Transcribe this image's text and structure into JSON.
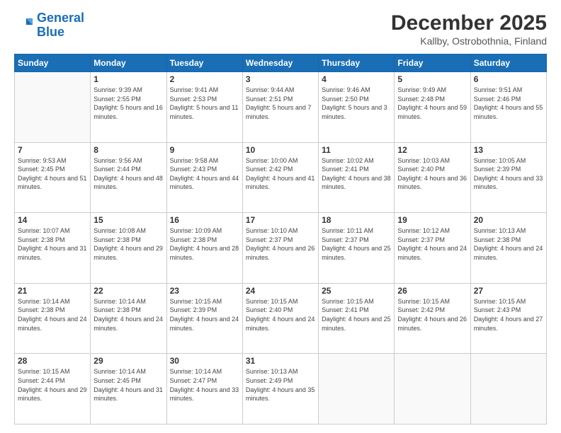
{
  "header": {
    "logo_line1": "General",
    "logo_line2": "Blue",
    "title": "December 2025",
    "subtitle": "Kallby, Ostrobothnia, Finland"
  },
  "calendar": {
    "weekdays": [
      "Sunday",
      "Monday",
      "Tuesday",
      "Wednesday",
      "Thursday",
      "Friday",
      "Saturday"
    ],
    "weeks": [
      [
        {
          "day": "",
          "empty": true
        },
        {
          "day": "1",
          "sunrise": "Sunrise: 9:39 AM",
          "sunset": "Sunset: 2:55 PM",
          "daylight": "Daylight: 5 hours and 16 minutes."
        },
        {
          "day": "2",
          "sunrise": "Sunrise: 9:41 AM",
          "sunset": "Sunset: 2:53 PM",
          "daylight": "Daylight: 5 hours and 11 minutes."
        },
        {
          "day": "3",
          "sunrise": "Sunrise: 9:44 AM",
          "sunset": "Sunset: 2:51 PM",
          "daylight": "Daylight: 5 hours and 7 minutes."
        },
        {
          "day": "4",
          "sunrise": "Sunrise: 9:46 AM",
          "sunset": "Sunset: 2:50 PM",
          "daylight": "Daylight: 5 hours and 3 minutes."
        },
        {
          "day": "5",
          "sunrise": "Sunrise: 9:49 AM",
          "sunset": "Sunset: 2:48 PM",
          "daylight": "Daylight: 4 hours and 59 minutes."
        },
        {
          "day": "6",
          "sunrise": "Sunrise: 9:51 AM",
          "sunset": "Sunset: 2:46 PM",
          "daylight": "Daylight: 4 hours and 55 minutes."
        }
      ],
      [
        {
          "day": "7",
          "sunrise": "Sunrise: 9:53 AM",
          "sunset": "Sunset: 2:45 PM",
          "daylight": "Daylight: 4 hours and 51 minutes."
        },
        {
          "day": "8",
          "sunrise": "Sunrise: 9:56 AM",
          "sunset": "Sunset: 2:44 PM",
          "daylight": "Daylight: 4 hours and 48 minutes."
        },
        {
          "day": "9",
          "sunrise": "Sunrise: 9:58 AM",
          "sunset": "Sunset: 2:43 PM",
          "daylight": "Daylight: 4 hours and 44 minutes."
        },
        {
          "day": "10",
          "sunrise": "Sunrise: 10:00 AM",
          "sunset": "Sunset: 2:42 PM",
          "daylight": "Daylight: 4 hours and 41 minutes."
        },
        {
          "day": "11",
          "sunrise": "Sunrise: 10:02 AM",
          "sunset": "Sunset: 2:41 PM",
          "daylight": "Daylight: 4 hours and 38 minutes."
        },
        {
          "day": "12",
          "sunrise": "Sunrise: 10:03 AM",
          "sunset": "Sunset: 2:40 PM",
          "daylight": "Daylight: 4 hours and 36 minutes."
        },
        {
          "day": "13",
          "sunrise": "Sunrise: 10:05 AM",
          "sunset": "Sunset: 2:39 PM",
          "daylight": "Daylight: 4 hours and 33 minutes."
        }
      ],
      [
        {
          "day": "14",
          "sunrise": "Sunrise: 10:07 AM",
          "sunset": "Sunset: 2:38 PM",
          "daylight": "Daylight: 4 hours and 31 minutes."
        },
        {
          "day": "15",
          "sunrise": "Sunrise: 10:08 AM",
          "sunset": "Sunset: 2:38 PM",
          "daylight": "Daylight: 4 hours and 29 minutes."
        },
        {
          "day": "16",
          "sunrise": "Sunrise: 10:09 AM",
          "sunset": "Sunset: 2:38 PM",
          "daylight": "Daylight: 4 hours and 28 minutes."
        },
        {
          "day": "17",
          "sunrise": "Sunrise: 10:10 AM",
          "sunset": "Sunset: 2:37 PM",
          "daylight": "Daylight: 4 hours and 26 minutes."
        },
        {
          "day": "18",
          "sunrise": "Sunrise: 10:11 AM",
          "sunset": "Sunset: 2:37 PM",
          "daylight": "Daylight: 4 hours and 25 minutes."
        },
        {
          "day": "19",
          "sunrise": "Sunrise: 10:12 AM",
          "sunset": "Sunset: 2:37 PM",
          "daylight": "Daylight: 4 hours and 24 minutes."
        },
        {
          "day": "20",
          "sunrise": "Sunrise: 10:13 AM",
          "sunset": "Sunset: 2:38 PM",
          "daylight": "Daylight: 4 hours and 24 minutes."
        }
      ],
      [
        {
          "day": "21",
          "sunrise": "Sunrise: 10:14 AM",
          "sunset": "Sunset: 2:38 PM",
          "daylight": "Daylight: 4 hours and 24 minutes."
        },
        {
          "day": "22",
          "sunrise": "Sunrise: 10:14 AM",
          "sunset": "Sunset: 2:38 PM",
          "daylight": "Daylight: 4 hours and 24 minutes."
        },
        {
          "day": "23",
          "sunrise": "Sunrise: 10:15 AM",
          "sunset": "Sunset: 2:39 PM",
          "daylight": "Daylight: 4 hours and 24 minutes."
        },
        {
          "day": "24",
          "sunrise": "Sunrise: 10:15 AM",
          "sunset": "Sunset: 2:40 PM",
          "daylight": "Daylight: 4 hours and 24 minutes."
        },
        {
          "day": "25",
          "sunrise": "Sunrise: 10:15 AM",
          "sunset": "Sunset: 2:41 PM",
          "daylight": "Daylight: 4 hours and 25 minutes."
        },
        {
          "day": "26",
          "sunrise": "Sunrise: 10:15 AM",
          "sunset": "Sunset: 2:42 PM",
          "daylight": "Daylight: 4 hours and 26 minutes."
        },
        {
          "day": "27",
          "sunrise": "Sunrise: 10:15 AM",
          "sunset": "Sunset: 2:43 PM",
          "daylight": "Daylight: 4 hours and 27 minutes."
        }
      ],
      [
        {
          "day": "28",
          "sunrise": "Sunrise: 10:15 AM",
          "sunset": "Sunset: 2:44 PM",
          "daylight": "Daylight: 4 hours and 29 minutes."
        },
        {
          "day": "29",
          "sunrise": "Sunrise: 10:14 AM",
          "sunset": "Sunset: 2:45 PM",
          "daylight": "Daylight: 4 hours and 31 minutes."
        },
        {
          "day": "30",
          "sunrise": "Sunrise: 10:14 AM",
          "sunset": "Sunset: 2:47 PM",
          "daylight": "Daylight: 4 hours and 33 minutes."
        },
        {
          "day": "31",
          "sunrise": "Sunrise: 10:13 AM",
          "sunset": "Sunset: 2:49 PM",
          "daylight": "Daylight: 4 hours and 35 minutes."
        },
        {
          "day": "",
          "empty": true
        },
        {
          "day": "",
          "empty": true
        },
        {
          "day": "",
          "empty": true
        }
      ]
    ]
  }
}
